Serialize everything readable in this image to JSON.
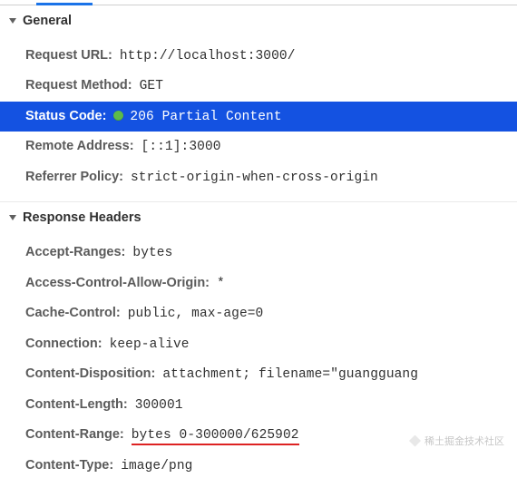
{
  "sections": {
    "general": {
      "title": "General",
      "request_url": {
        "label": "Request URL:",
        "value": "http://localhost:3000/"
      },
      "request_method": {
        "label": "Request Method:",
        "value": "GET"
      },
      "status_code": {
        "label": "Status Code:",
        "value": "206 Partial Content"
      },
      "remote_address": {
        "label": "Remote Address:",
        "value": "[::1]:3000"
      },
      "referrer_policy": {
        "label": "Referrer Policy:",
        "value": "strict-origin-when-cross-origin"
      }
    },
    "response_headers": {
      "title": "Response Headers",
      "accept_ranges": {
        "label": "Accept-Ranges:",
        "value": "bytes"
      },
      "access_control_allow_origin": {
        "label": "Access-Control-Allow-Origin:",
        "value": "*"
      },
      "cache_control": {
        "label": "Cache-Control:",
        "value": "public, max-age=0"
      },
      "connection": {
        "label": "Connection:",
        "value": "keep-alive"
      },
      "content_disposition": {
        "label": "Content-Disposition:",
        "value": "attachment; filename=\"guangguang"
      },
      "content_length": {
        "label": "Content-Length:",
        "value": "300001"
      },
      "content_range": {
        "label": "Content-Range:",
        "value": "bytes 0-300000/625902"
      },
      "content_type": {
        "label": "Content-Type:",
        "value": "image/png"
      }
    }
  },
  "watermark": "稀土掘金技术社区"
}
